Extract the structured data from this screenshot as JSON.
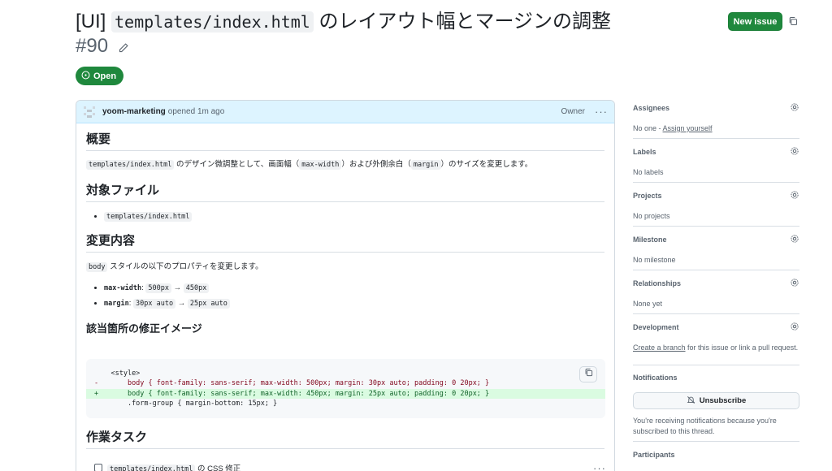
{
  "issue": {
    "title_prefix": "[UI] ",
    "title_code": "templates/index.html",
    "title_suffix": " のレイアウト幅とマージンの調整",
    "number": "#90",
    "state": "Open",
    "new_issue_label": "New issue"
  },
  "comment": {
    "author": "yoom-marketing",
    "action": "opened",
    "time": "1m ago",
    "role": "Owner",
    "overview_heading": "概要",
    "overview": {
      "file": "templates/index.html",
      "t1": " のデザイン微調整として、画面幅（",
      "prop1": "max-width",
      "t2": "）および外側余白（",
      "prop2": "margin",
      "t3": "）のサイズを変更します。"
    },
    "target_heading": "対象ファイル",
    "target_files": [
      "templates/index.html"
    ],
    "changes_heading": "変更内容",
    "changes_intro_code": "body",
    "changes_intro": " スタイルの以下のプロパティを変更します。",
    "changes": [
      {
        "prop": "max-width",
        "sep": ": ",
        "from": "500px",
        "arrow": " → ",
        "to": "450px"
      },
      {
        "prop": "margin",
        "sep": ": ",
        "from": "30px auto",
        "arrow": " → ",
        "to": "25px auto"
      }
    ],
    "fix_heading": "該当箇所の修正イメージ",
    "code_lines": [
      {
        "marker": " ",
        "text": "   <style>",
        "kind": "ctx"
      },
      {
        "marker": "-",
        "text": "       body { font-family: sans-serif; max-width: 500px; margin: 30px auto; padding: 0 20px; }",
        "kind": "del"
      },
      {
        "marker": "+",
        "text": "       body { font-family: sans-serif; max-width: 450px; margin: 25px auto; padding: 0 20px; }",
        "kind": "add"
      },
      {
        "marker": " ",
        "text": "       .form-group { margin-bottom: 15px; }",
        "kind": "ctx"
      }
    ],
    "tasks_heading": "作業タスク",
    "task1_code": "templates/index.html",
    "task1_text": " の CSS 修正"
  },
  "sidebar": {
    "assignees": {
      "title": "Assignees",
      "value": "No one - ",
      "link": "Assign yourself"
    },
    "labels": {
      "title": "Labels",
      "value": "No labels"
    },
    "projects": {
      "title": "Projects",
      "value": "No projects"
    },
    "milestone": {
      "title": "Milestone",
      "value": "No milestone"
    },
    "relationships": {
      "title": "Relationships",
      "value": "None yet"
    },
    "development": {
      "title": "Development",
      "link": "Create a branch",
      "value": " for this issue or link a pull request."
    },
    "notifications": {
      "title": "Notifications",
      "button": "Unsubscribe",
      "text": "You're receiving notifications because you're subscribed to this thread."
    },
    "participants": {
      "title": "Participants"
    }
  },
  "colors": {
    "accent_green": "#1f883d",
    "header_blue": "#ddf4ff"
  },
  "icons": [
    "pencil-icon",
    "copy-icon",
    "issue-open-icon",
    "kebab-icon",
    "gear-icon",
    "bell-slash-icon"
  ]
}
